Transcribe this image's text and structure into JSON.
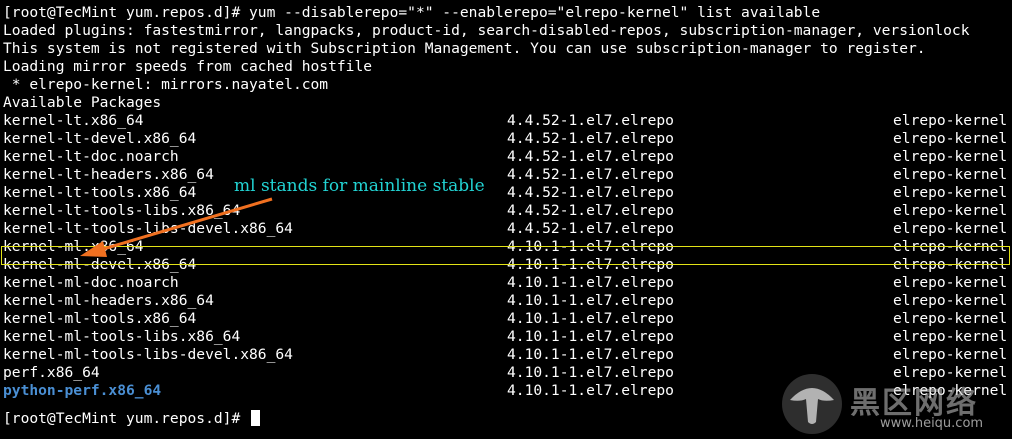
{
  "terminal": {
    "command_prompt": "[root@TecMint yum.repos.d]# ",
    "command": "yum --disablerepo=\"*\" --enablerepo=\"elrepo-kernel\" list available",
    "output_lines": [
      "Loaded plugins: fastestmirror, langpacks, product-id, search-disabled-repos, subscription-manager, versionlock",
      "This system is not registered with Subscription Management. You can use subscription-manager to register.",
      "Loading mirror speeds from cached hostfile",
      " * elrepo-kernel: mirrors.nayatel.com",
      "Available Packages"
    ],
    "packages": [
      {
        "name": "kernel-lt.x86_64",
        "version": "4.4.52-1.el7.elrepo",
        "repo": "elrepo-kernel"
      },
      {
        "name": "kernel-lt-devel.x86_64",
        "version": "4.4.52-1.el7.elrepo",
        "repo": "elrepo-kernel"
      },
      {
        "name": "kernel-lt-doc.noarch",
        "version": "4.4.52-1.el7.elrepo",
        "repo": "elrepo-kernel"
      },
      {
        "name": "kernel-lt-headers.x86_64",
        "version": "4.4.52-1.el7.elrepo",
        "repo": "elrepo-kernel"
      },
      {
        "name": "kernel-lt-tools.x86_64",
        "version": "4.4.52-1.el7.elrepo",
        "repo": "elrepo-kernel"
      },
      {
        "name": "kernel-lt-tools-libs.x86_64",
        "version": "4.4.52-1.el7.elrepo",
        "repo": "elrepo-kernel"
      },
      {
        "name": "kernel-lt-tools-libs-devel.x86_64",
        "version": "4.4.52-1.el7.elrepo",
        "repo": "elrepo-kernel"
      },
      {
        "name": "kernel-ml.x86_64",
        "version": "4.10.1-1.el7.elrepo",
        "repo": "elrepo-kernel"
      },
      {
        "name": "kernel-ml-devel.x86_64",
        "version": "4.10.1-1.el7.elrepo",
        "repo": "elrepo-kernel"
      },
      {
        "name": "kernel-ml-doc.noarch",
        "version": "4.10.1-1.el7.elrepo",
        "repo": "elrepo-kernel"
      },
      {
        "name": "kernel-ml-headers.x86_64",
        "version": "4.10.1-1.el7.elrepo",
        "repo": "elrepo-kernel"
      },
      {
        "name": "kernel-ml-tools.x86_64",
        "version": "4.10.1-1.el7.elrepo",
        "repo": "elrepo-kernel"
      },
      {
        "name": "kernel-ml-tools-libs.x86_64",
        "version": "4.10.1-1.el7.elrepo",
        "repo": "elrepo-kernel"
      },
      {
        "name": "kernel-ml-tools-libs-devel.x86_64",
        "version": "4.10.1-1.el7.elrepo",
        "repo": "elrepo-kernel"
      },
      {
        "name": "perf.x86_64",
        "version": "4.10.1-1.el7.elrepo",
        "repo": "elrepo-kernel"
      },
      {
        "name": "python-perf.x86_64",
        "version": "4.10.1-1.el7.elrepo",
        "repo": "elrepo-kernel"
      }
    ],
    "highlighted_package": "kernel-ml.x86_64",
    "installed_package": "python-perf.x86_64",
    "final_prompt": "[root@TecMint yum.repos.d]# "
  },
  "annotation": {
    "text": "ml stands for mainline stable",
    "color": "#22d3d3",
    "arrow_color": "#f07020"
  },
  "watermark": {
    "title": "黑区网络",
    "url": "www.heiqu.com"
  },
  "colors": {
    "background": "#000000",
    "foreground": "#ffffff",
    "highlight_box": "#e3e317",
    "installed_name": "#4a8fd4"
  }
}
